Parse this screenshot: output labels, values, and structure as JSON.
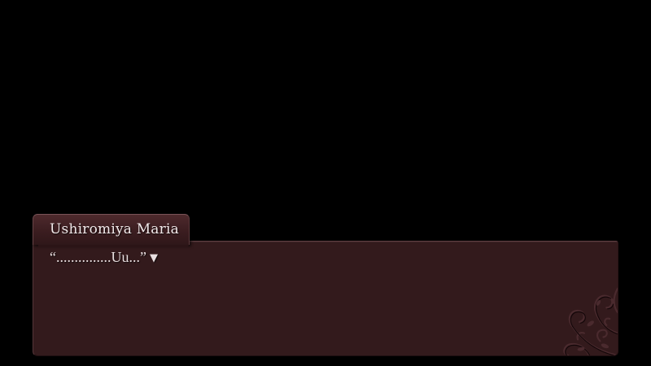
{
  "dialogue": {
    "speaker": "Ushiromiya Maria",
    "text": "“...............Uu...”",
    "advance_indicator": "▼"
  },
  "icons": {
    "advance": "triangle-down-icon",
    "ornament": "floral-ornament-icon"
  },
  "colors": {
    "background": "#000000",
    "box_fill": "#331a1c",
    "tab_fill": "#4e2a2d",
    "text": "#e9dfe0"
  }
}
